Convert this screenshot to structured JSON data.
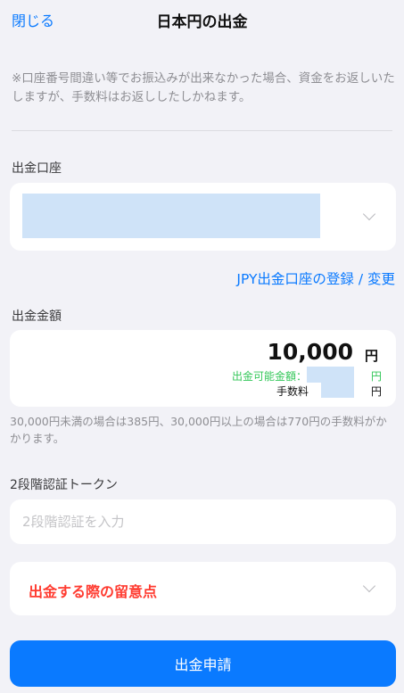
{
  "header": {
    "close_label": "閉じる",
    "title": "日本円の出金"
  },
  "notice": "※口座番号間違い等でお振込みが出来なかった場合、資金をお返しいたしますが、手数料はお返ししたしかねます。",
  "account": {
    "label": "出金口座",
    "register_link": "JPY出金口座の登録 / 変更"
  },
  "amount": {
    "label": "出金金額",
    "value": "10,000",
    "unit": "円",
    "available_label": "出金可能金額：",
    "available_unit": "円",
    "fee_label": "手数料",
    "fee_unit": "円"
  },
  "fee_note": "30,000円未満の場合は385円、30,000円以上の場合は770円の手数料がかかります。",
  "token": {
    "label": "2段階認証トークン",
    "placeholder": "2段階認証を入力"
  },
  "caution": {
    "label": "出金する際の留意点"
  },
  "submit_label": "出金申請",
  "colors": {
    "accent": "#0a7aff",
    "warning": "#ff3b30",
    "available": "#34c759",
    "background": "#f2f2f7"
  }
}
